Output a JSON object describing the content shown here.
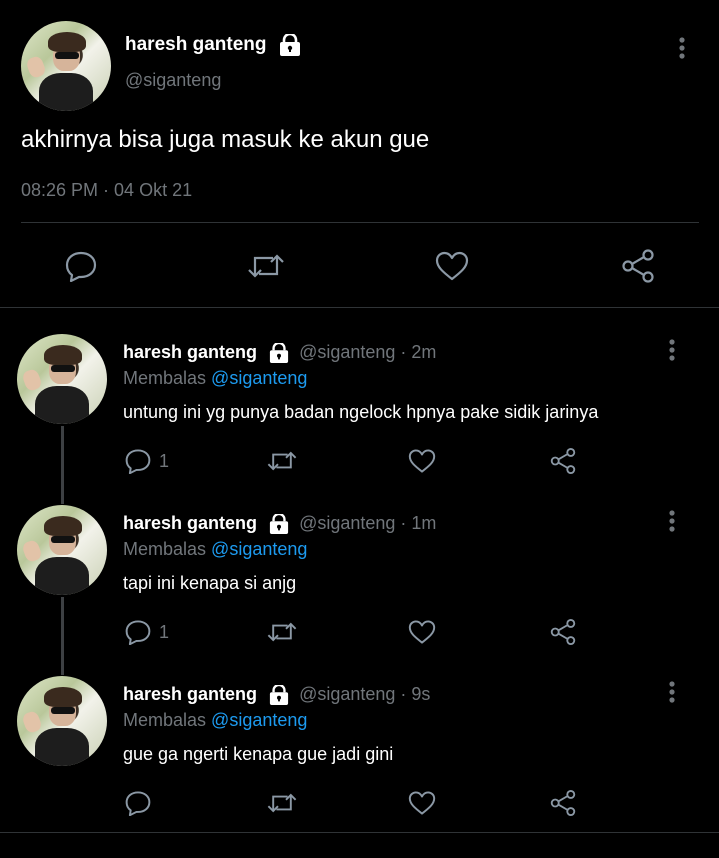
{
  "main_tweet": {
    "author_name": "haresh ganteng",
    "handle": "@siganteng",
    "text": "akhirnya bisa juga masuk ke akun gue",
    "timestamp": "08:26 PM · 04 Okt 21",
    "actions": [
      "reply-icon",
      "retweet-icon",
      "like-icon",
      "share-icon"
    ]
  },
  "replies": [
    {
      "author_name": "haresh ganteng",
      "meta": "@siganteng · 2m",
      "replying_label": "Membalas",
      "replying_to": "@siganteng",
      "text": "untung ini yg punya badan ngelock hpnya pake sidik jarinya",
      "reply_count": "1"
    },
    {
      "author_name": "haresh ganteng",
      "meta": "@siganteng · 1m",
      "replying_label": "Membalas",
      "replying_to": "@siganteng",
      "text": "tapi ini kenapa si anjg",
      "reply_count": "1"
    },
    {
      "author_name": "haresh ganteng",
      "meta": "@siganteng · 9s",
      "replying_label": "Membalas",
      "replying_to": "@siganteng",
      "text": "gue ga ngerti kenapa gue jadi gini",
      "reply_count": ""
    }
  ],
  "colors": {
    "background": "#000000",
    "secondary_text": "#71767b",
    "mention": "#1d9bf0",
    "divider": "#2f3336"
  }
}
